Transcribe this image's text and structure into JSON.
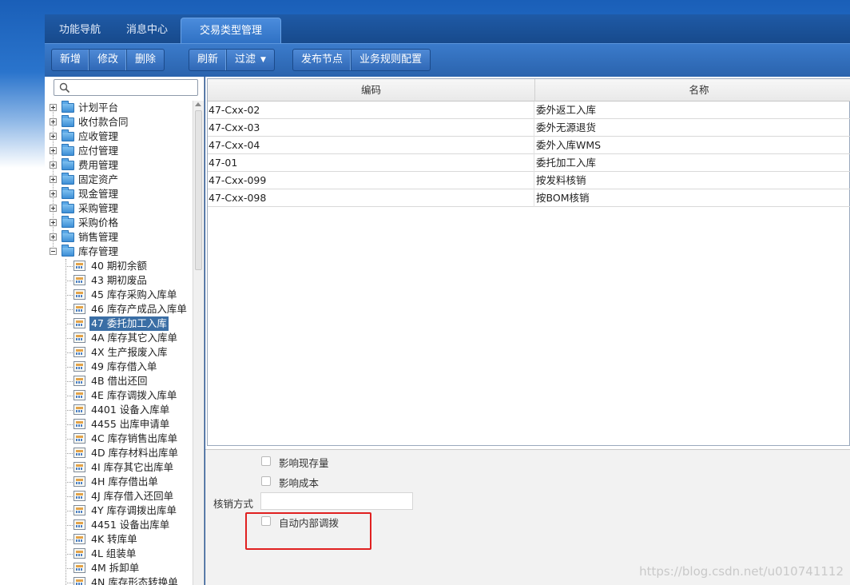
{
  "header": {
    "tabs": [
      {
        "label": "功能导航"
      },
      {
        "label": "消息中心"
      },
      {
        "label": "交易类型管理",
        "active": true
      }
    ]
  },
  "toolbar": {
    "group1": [
      "新增",
      "修改",
      "删除"
    ],
    "group2": [
      "刷新",
      "过滤"
    ],
    "group3": [
      "发布节点",
      "业务规则配置"
    ]
  },
  "search": {
    "placeholder": ""
  },
  "tree": {
    "folders": [
      {
        "label": "计划平台",
        "expanded": false
      },
      {
        "label": "收付款合同",
        "expanded": false
      },
      {
        "label": "应收管理",
        "expanded": false
      },
      {
        "label": "应付管理",
        "expanded": false
      },
      {
        "label": "费用管理",
        "expanded": false
      },
      {
        "label": "固定资产",
        "expanded": false
      },
      {
        "label": "现金管理",
        "expanded": false
      },
      {
        "label": "采购管理",
        "expanded": false
      },
      {
        "label": "采购价格",
        "expanded": false
      },
      {
        "label": "销售管理",
        "expanded": false
      },
      {
        "label": "库存管理",
        "expanded": true
      }
    ],
    "children": [
      {
        "label": "40 期初余额"
      },
      {
        "label": "43 期初废品"
      },
      {
        "label": "45 库存采购入库单"
      },
      {
        "label": "46 库存产成品入库单"
      },
      {
        "label": "47 委托加工入库",
        "selected": true
      },
      {
        "label": "4A 库存其它入库单"
      },
      {
        "label": "4X 生产报废入库"
      },
      {
        "label": "49 库存借入单"
      },
      {
        "label": "4B 借出还回"
      },
      {
        "label": "4E 库存调拨入库单"
      },
      {
        "label": "4401 设备入库单"
      },
      {
        "label": "4455 出库申请单"
      },
      {
        "label": "4C 库存销售出库单"
      },
      {
        "label": "4D 库存材料出库单"
      },
      {
        "label": "4I 库存其它出库单"
      },
      {
        "label": "4H 库存借出单"
      },
      {
        "label": "4J 库存借入还回单"
      },
      {
        "label": "4Y 库存调拨出库单"
      },
      {
        "label": "4451 设备出库单"
      },
      {
        "label": "4K 转库单"
      },
      {
        "label": "4L 组装单"
      },
      {
        "label": "4M 拆卸单"
      },
      {
        "label": "4N 库存形态转换单"
      }
    ]
  },
  "grid": {
    "columns": [
      "编码",
      "名称"
    ],
    "rows": [
      [
        "47-Cxx-02",
        "委外返工入库"
      ],
      [
        "47-Cxx-03",
        "委外无源退货"
      ],
      [
        "47-Cxx-04",
        "委外入库WMS"
      ],
      [
        "47-01",
        "委托加工入库"
      ],
      [
        "47-Cxx-099",
        "按发料核销"
      ],
      [
        "47-Cxx-098",
        "按BOM核销"
      ]
    ]
  },
  "form": {
    "affect_stock": "影响现存量",
    "affect_cost": "影响成本",
    "writeoff_label": "核销方式",
    "writeoff_value": "",
    "auto_transfer": "自动内部调拨"
  },
  "watermark": "https://blog.csdn.net/u010741112",
  "colors": {
    "highlight": "#e02020",
    "selected": "#3a6ea5",
    "toolbar": "#2a63ad"
  }
}
